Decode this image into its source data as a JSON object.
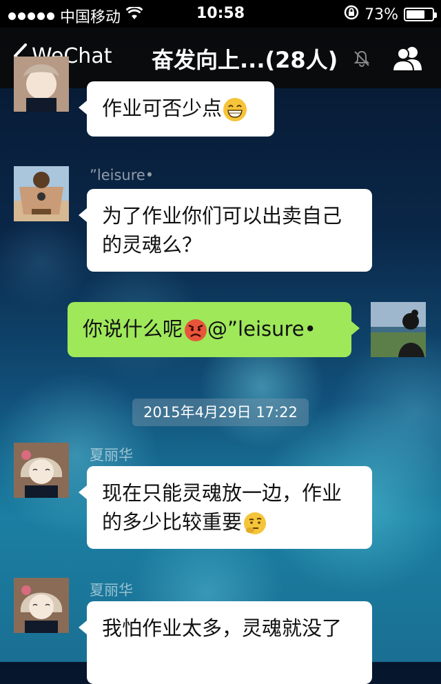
{
  "status_bar": {
    "carrier": "中国移动",
    "time": "10:58",
    "battery": "73%",
    "battery_level": 0.73
  },
  "nav": {
    "back_label": "WeChat",
    "title": "奋发向上...(28人)"
  },
  "messages": [
    {
      "text": "作业可否少点",
      "emoji": "grinning-face"
    },
    {
      "sender": "”leisure•",
      "text": "为了作业你们可以出卖自己的灵魂么？"
    },
    {
      "text": "你说什么呢",
      "emoji": "angry-face",
      "mention": "@”leisure•"
    },
    {
      "sender": "夏丽华",
      "text": "现在只能灵魂放一边，作业的多少比较重要",
      "emoji": "thinking-face"
    },
    {
      "sender": "夏丽华",
      "text": "我怕作业太多，灵魂就没了"
    }
  ],
  "timestamp": "2015年4月29日 17:22",
  "colors": {
    "outgoing_bubble": "#9fe85a",
    "incoming_bubble": "#ffffff",
    "nav_bg": "#0a0a0a"
  }
}
